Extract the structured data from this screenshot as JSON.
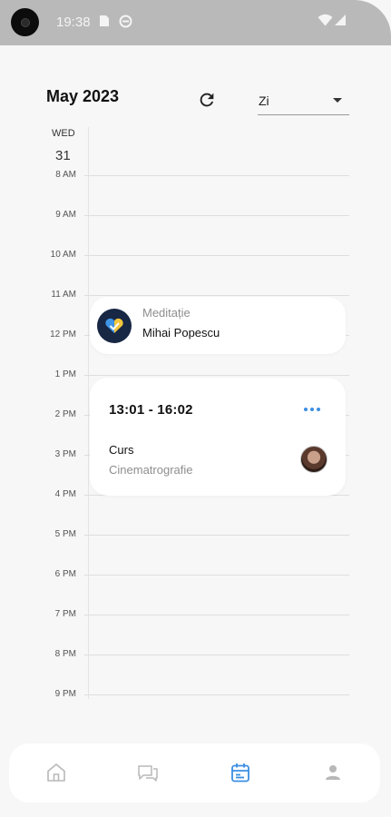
{
  "status_bar": {
    "time": "19:38",
    "icons": [
      "camera-cutout",
      "sim-card-icon",
      "vpn-icon",
      "wifi-icon",
      "signal-icon"
    ]
  },
  "header": {
    "month_title": "May 2023",
    "refresh_icon": "refresh-icon",
    "view_select": {
      "value": "Zi",
      "caret_icon": "dropdown-caret-icon"
    }
  },
  "day_header": {
    "weekday": "WED",
    "day": "31"
  },
  "hours": [
    "8 AM",
    "9 AM",
    "10 AM",
    "11 AM",
    "12 PM",
    "1 PM",
    "2 PM",
    "3 PM",
    "4 PM",
    "5 PM",
    "6 PM",
    "7 PM",
    "8 PM",
    "9 PM"
  ],
  "events": [
    {
      "type": "Meditație",
      "person": "Mihai Popescu",
      "icon": "app-logo-heart-icon"
    },
    {
      "time": "13:01 - 16:02",
      "type": "Curs",
      "subject": "Cinematrografie",
      "more_icon": "more-dots-icon",
      "avatar": "avatar"
    }
  ],
  "bottom_nav": {
    "items": [
      {
        "name": "home",
        "icon": "home-icon",
        "active": false
      },
      {
        "name": "chat",
        "icon": "chat-icon",
        "active": false
      },
      {
        "name": "calendar",
        "icon": "calendar-icon",
        "active": true
      },
      {
        "name": "profile",
        "icon": "person-icon",
        "active": false
      }
    ]
  },
  "colors": {
    "accent": "#3b8ee2",
    "status_bar_bg": "#b9b9b9",
    "page_bg": "#f7f7f8",
    "card_bg": "#ffffff",
    "nav_icon_inactive": "#b8b8b8"
  }
}
